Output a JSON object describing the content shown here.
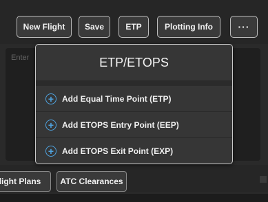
{
  "toolbar": {
    "new_flight": "New Flight",
    "save": "Save",
    "etp": "ETP",
    "plotting_info": "Plotting Info",
    "more": "···"
  },
  "editor": {
    "placeholder": "Enter"
  },
  "dialog": {
    "title": "ETP/ETOPS",
    "items": [
      {
        "label": "Add Equal Time Point (ETP)",
        "icon": "plus-circle-icon"
      },
      {
        "label": "Add ETOPS Entry Point (EEP)",
        "icon": "plus-circle-icon"
      },
      {
        "label": "Add ETOPS Exit Point (EXP)",
        "icon": "plus-circle-icon"
      }
    ]
  },
  "bottom_tabs": {
    "flight_plans": "light Plans",
    "atc_clearances": "ATC Clearances"
  },
  "colors": {
    "accent": "#4ea3e0",
    "background": "#2a2a2a",
    "dialog_bg": "#363636"
  }
}
